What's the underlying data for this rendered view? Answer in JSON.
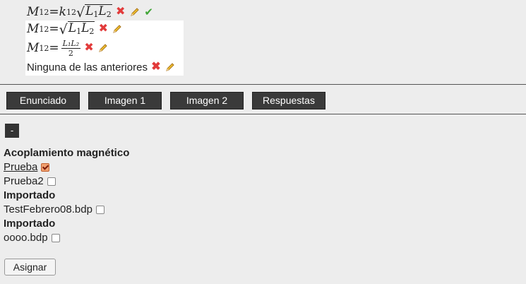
{
  "answers": {
    "a1": {
      "M": "M",
      "sub12": "12",
      "eq": " = ",
      "k": "k",
      "root": "√",
      "L1": "L",
      "s1": "1",
      "L2": "L",
      "s2": "2"
    },
    "a2": {
      "M": "M",
      "sub12": "12",
      "eq": " = ",
      "root": "√",
      "L1": "L",
      "s1": "1",
      "L2": "L",
      "s2": "2"
    },
    "a3": {
      "M": "M",
      "sub12": "12",
      "eq": " = ",
      "num": "L₁L₂",
      "den": "2"
    },
    "a4": {
      "text": "Ninguna de las anteriores"
    }
  },
  "icons": {
    "delete": "✖",
    "edit": "pencil-icon",
    "correct": "✔"
  },
  "tabs": [
    "Enunciado",
    "Imagen 1",
    "Imagen 2",
    "Respuestas"
  ],
  "collapse_label": "-",
  "tree": {
    "topic": "Acoplamiento magnético",
    "items1": [
      {
        "label": "Prueba",
        "checked": true
      },
      {
        "label": "Prueba2",
        "checked": false
      }
    ],
    "group1": "Importado",
    "file1": "TestFebrero08.bdp",
    "group2": "Importado",
    "file2": "oooo.bdp"
  },
  "assign_label": "Asignar",
  "colors": {
    "background": "#ededed",
    "tab_bg": "#3a3a3a",
    "delete": "#e23b3b",
    "correct": "#3fa535"
  }
}
